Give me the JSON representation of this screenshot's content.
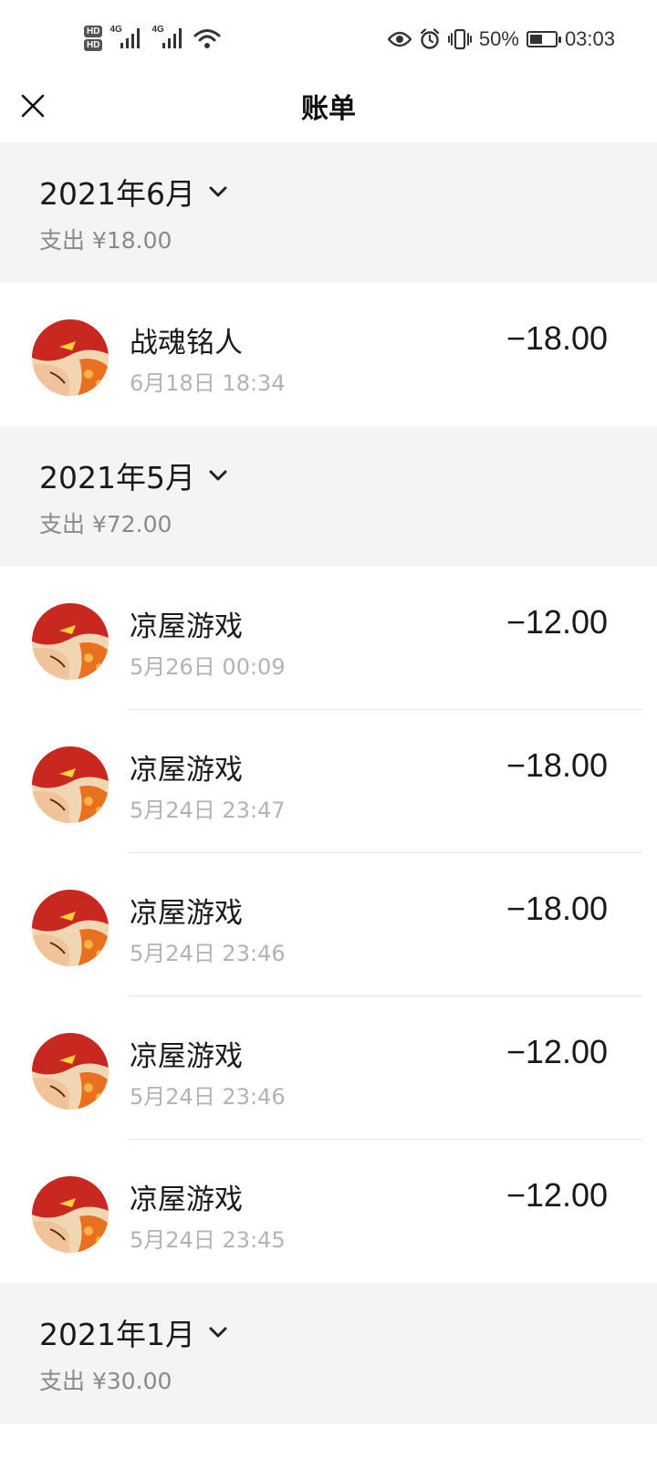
{
  "status_bar": {
    "hd1": "HD",
    "hd2": "HD",
    "net1": "4G",
    "net2": "4G",
    "battery_percent": "50%",
    "battery_level": 0.5,
    "time": "03:03",
    "icons": [
      "eye-icon",
      "alarm-icon",
      "vibrate-icon",
      "wifi-icon",
      "battery-icon"
    ]
  },
  "header": {
    "title": "账单",
    "close_icon": "close-icon"
  },
  "sections": [
    {
      "month": "2021年6月",
      "spend": "支出 ¥18.00",
      "items": [
        {
          "name": "战魂铭人",
          "time": "6月18日 18:34",
          "amount": "−18.00"
        }
      ]
    },
    {
      "month": "2021年5月",
      "spend": "支出 ¥72.00",
      "items": [
        {
          "name": "凉屋游戏",
          "time": "5月26日 00:09",
          "amount": "−12.00"
        },
        {
          "name": "凉屋游戏",
          "time": "5月24日 23:47",
          "amount": "−18.00"
        },
        {
          "name": "凉屋游戏",
          "time": "5月24日 23:46",
          "amount": "−18.00"
        },
        {
          "name": "凉屋游戏",
          "time": "5月24日 23:46",
          "amount": "−12.00"
        },
        {
          "name": "凉屋游戏",
          "time": "5月24日 23:45",
          "amount": "−12.00"
        }
      ]
    },
    {
      "month": "2021年1月",
      "spend": "支出 ¥30.00",
      "items": []
    }
  ],
  "colors": {
    "section_bg": "#f4f4f4",
    "secondary_text": "#8a8a8a",
    "time_text": "#b3b3b3"
  }
}
